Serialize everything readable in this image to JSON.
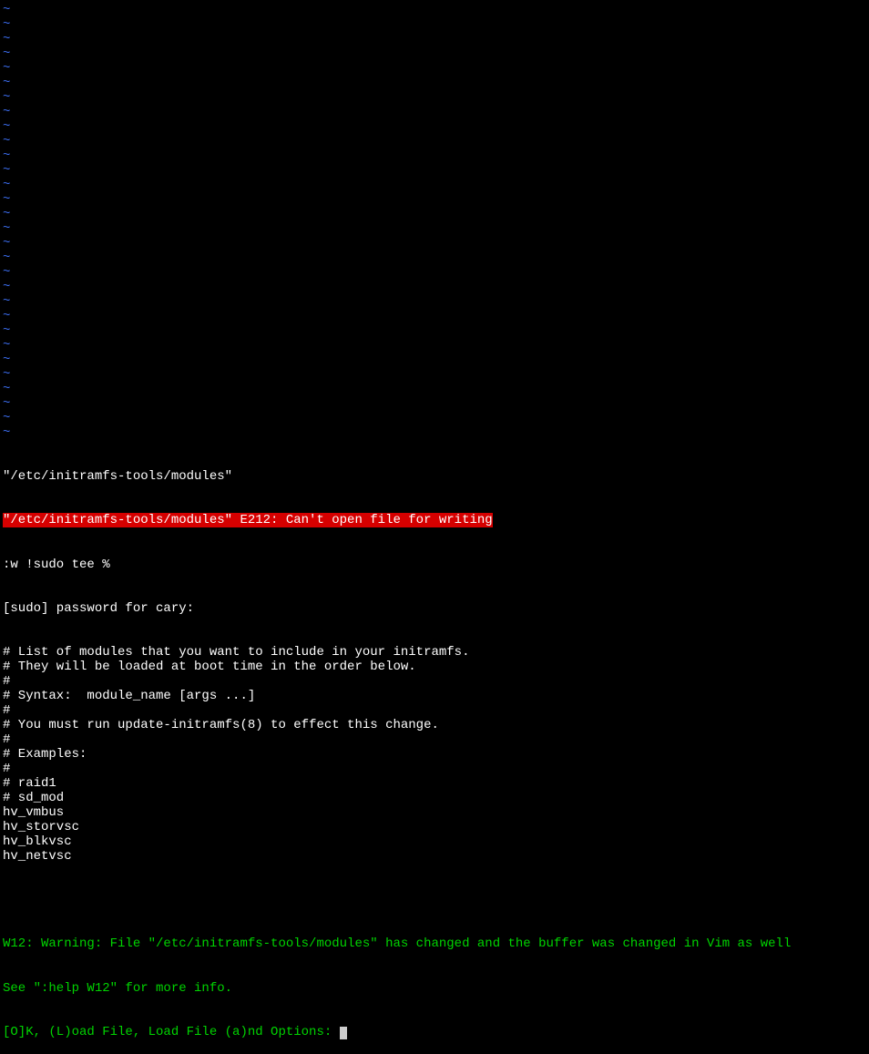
{
  "tilde_char": "~",
  "tilde_count": 30,
  "status": {
    "file_path_quoted": "\"/etc/initramfs-tools/modules\"",
    "error_line": "\"/etc/initramfs-tools/modules\" E212: Can't open file for writing",
    "command": ":w !sudo tee %",
    "sudo_prompt": "[sudo] password for cary:",
    "file_contents": [
      "# List of modules that you want to include in your initramfs.",
      "# They will be loaded at boot time in the order below.",
      "#",
      "# Syntax:  module_name [args ...]",
      "#",
      "# You must run update-initramfs(8) to effect this change.",
      "#",
      "# Examples:",
      "#",
      "# raid1",
      "# sd_mod",
      "hv_vmbus",
      "hv_storvsc",
      "hv_blkvsc",
      "hv_netvsc"
    ],
    "blank_line": "",
    "warning_line1": "W12: Warning: File \"/etc/initramfs-tools/modules\" has changed and the buffer was changed in Vim as well",
    "warning_line2": "See \":help W12\" for more info.",
    "prompt": "[O]K, (L)oad File, Load File (a)nd Options: "
  }
}
